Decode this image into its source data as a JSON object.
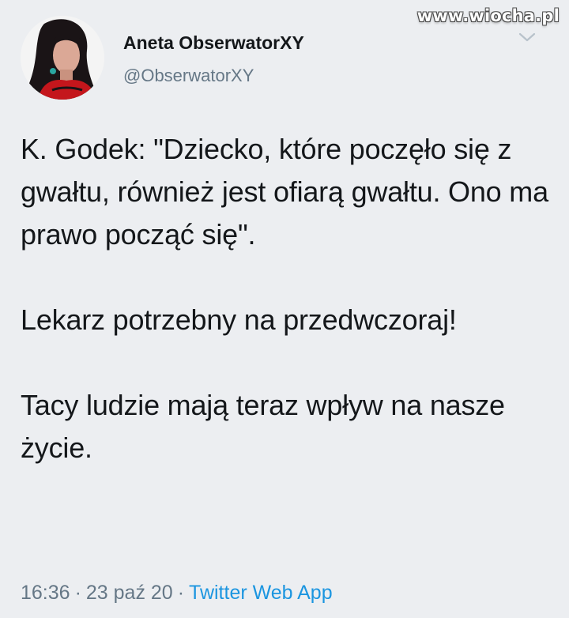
{
  "watermark": "www.wiocha.pl",
  "user": {
    "display_name": "Aneta ObserwatorXY",
    "handle": "@ObserwatorXY"
  },
  "tweet": {
    "paragraphs": [
      "K. Godek: \"Dziecko, które poczęło się z gwałtu, również jest ofiarą gwałtu. Ono ma prawo począć się\".",
      "Lekarz potrzebny na przedwczoraj!",
      "Tacy ludzie mają teraz wpływ na nasze życie."
    ],
    "time": "16:36",
    "date": "23 paź 20",
    "separator": "·",
    "source": "Twitter Web App"
  },
  "colors": {
    "background": "#eceef1",
    "text": "#14171a",
    "muted": "#657786",
    "link": "#1b95e0"
  },
  "icons": {
    "menu": "chevron-down-icon",
    "avatar": "profile-photo"
  }
}
